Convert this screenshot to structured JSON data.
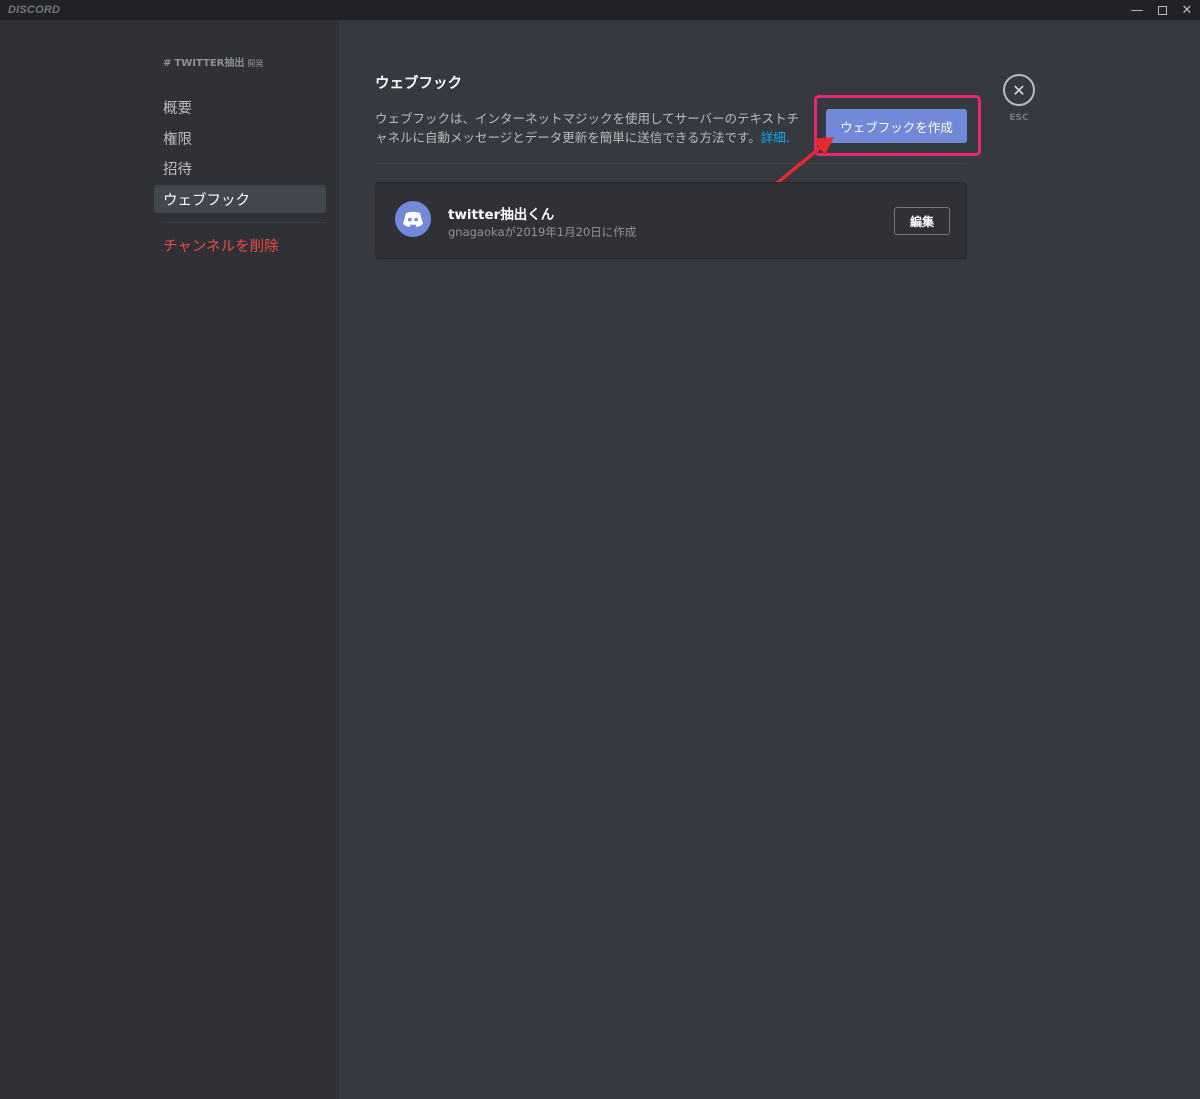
{
  "app": {
    "brand": "DISCORD",
    "window_controls": {
      "minimize": "—",
      "close": "✕"
    }
  },
  "sidebar": {
    "header": {
      "hash": "#",
      "channel": "TWITTER抽出",
      "category": "開発"
    },
    "items": [
      {
        "label": "概要",
        "active": false
      },
      {
        "label": "権限",
        "active": false
      },
      {
        "label": "招待",
        "active": false
      },
      {
        "label": "ウェブフック",
        "active": true
      }
    ],
    "delete_label": "チャンネルを削除"
  },
  "main": {
    "title": "ウェブフック",
    "description": "ウェブフックは、インターネットマジックを使用してサーバーのテキストチャネルに自動メッセージとデータ更新を簡単に送信できる方法です。",
    "link_label": "詳細.",
    "create_button": "ウェブフックを作成",
    "close": {
      "icon": "✕",
      "label": "ESC"
    },
    "webhooks": [
      {
        "name": "twitter抽出くん",
        "created": "gnagaokaが2019年1月20日に作成",
        "edit_label": "編集",
        "avatar_icon": "discord-logo-icon"
      }
    ]
  },
  "colors": {
    "background": "#36393f",
    "sidebar": "#2f3136",
    "titlebar": "#202225",
    "blurple": "#7289da",
    "danger": "#f04747",
    "link": "#00b0f4",
    "annotation": "#e8296f"
  }
}
